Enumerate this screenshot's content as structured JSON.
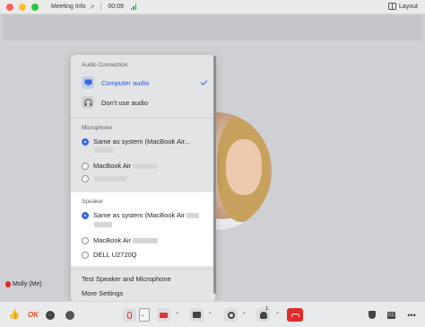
{
  "titlebar": {
    "meeting_info": "Meeting Info",
    "timer": "00:09",
    "layout": "Layout"
  },
  "participant": {
    "name": "Molly (Me)"
  },
  "menu": {
    "audio_connection": {
      "heading": "Audio Connection",
      "computer_audio": "Computer audio",
      "dont_use_audio": "Don't use audio"
    },
    "microphone": {
      "heading": "Microphone",
      "options": [
        "Same as system (MacBook Air...",
        "MacBook Air"
      ],
      "selected": 0
    },
    "speaker": {
      "heading": "Speaker",
      "options": [
        "Same as system (MacBook Air",
        "MacBook Air",
        "DELL U2720Q"
      ],
      "selected": 0
    },
    "test": "Test Speaker and Microphone",
    "more": "More Settings"
  },
  "toolbar": {
    "ok_reaction": "OK",
    "participant_count": "1",
    "cc": "CC",
    "more": "•••"
  },
  "colors": {
    "accent": "#3a66e0",
    "end_call": "#e02b2b",
    "muted": "#d33333"
  }
}
